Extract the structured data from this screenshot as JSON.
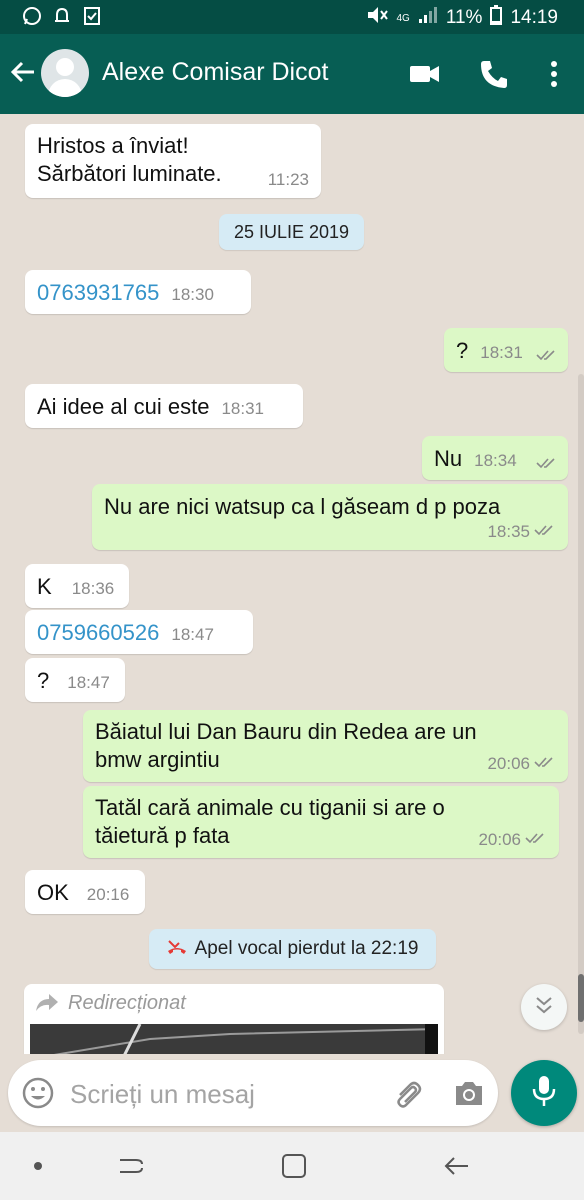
{
  "status_bar": {
    "battery": "11%",
    "time": "14:19",
    "network": "4G"
  },
  "header": {
    "contact_name": "Alexe Comisar Dicot"
  },
  "messages": [
    {
      "dir": "in",
      "lines": [
        "Hristos a înviat!",
        "Sărbători luminate."
      ],
      "time": "11:23"
    },
    {
      "date": "25 IULIE 2019"
    },
    {
      "dir": "in",
      "text": "0763931765",
      "link": true,
      "time": "18:30"
    },
    {
      "dir": "out",
      "text": "?",
      "time": "18:31"
    },
    {
      "dir": "in",
      "text": "Ai idee al cui este",
      "time": "18:31"
    },
    {
      "dir": "out",
      "text": "Nu",
      "time": "18:34"
    },
    {
      "dir": "out",
      "text": "Nu are nici watsup ca l găseam d p poza",
      "time": "18:35"
    },
    {
      "dir": "in",
      "text": "K",
      "time": "18:36"
    },
    {
      "dir": "in",
      "text": "0759660526",
      "link": true,
      "time": "18:47"
    },
    {
      "dir": "in",
      "text": "?",
      "time": "18:47"
    },
    {
      "dir": "out",
      "lines": [
        "Băiatul lui Dan Bauru din Redea are un",
        "bmw argintiu"
      ],
      "time": "20:06"
    },
    {
      "dir": "out",
      "lines": [
        "Tatăl cară animale cu tiganii si are o",
        "tăietură p fata"
      ],
      "time": "20:06"
    },
    {
      "dir": "in",
      "text": "OK",
      "time": "20:16"
    }
  ],
  "missed_call": "Apel vocal pierdut la 22:19",
  "forwarded_label": "Redirecționat",
  "input": {
    "placeholder": "Scrieți un mesaj"
  },
  "colors": {
    "header": "#075e54",
    "outgoing_bubble": "#dcf8c6",
    "incoming_bubble": "#ffffff",
    "mic_button": "#00897b",
    "chat_bg": "#e5ddd5"
  }
}
